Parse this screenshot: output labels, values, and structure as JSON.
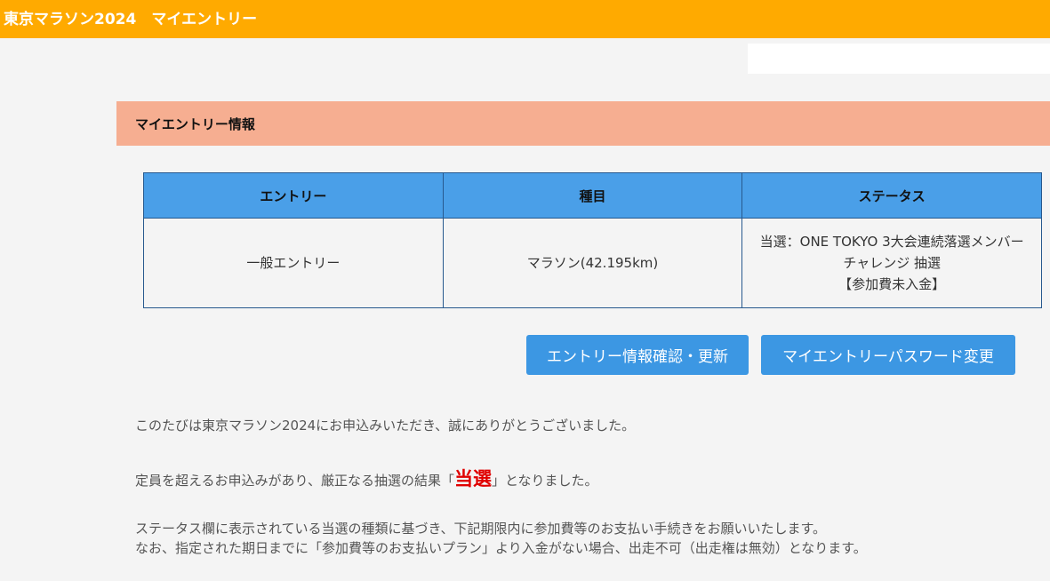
{
  "header": {
    "title": "東京マラソン2024　マイエントリー"
  },
  "section": {
    "title": "マイエントリー情報"
  },
  "table": {
    "headers": [
      "エントリー",
      "種目",
      "ステータス"
    ],
    "rows": [
      {
        "entry": "一般エントリー",
        "event": "マラソン(42.195km)",
        "status_line1": "当選：ONE TOKYO 3大会連続落選メンバーチャレンジ 抽選",
        "status_line2": "【参加費未入金】"
      }
    ]
  },
  "buttons": {
    "entry_info": "エントリー情報確認・更新",
    "password_change": "マイエントリーパスワード変更"
  },
  "messages": {
    "thanks": "このたびは東京マラソン2024にお申込みいただき、誠にありがとうございました。",
    "result_prefix": "定員を超えるお申込みがあり、厳正なる抽選の結果「",
    "result_highlight": "当選",
    "result_suffix": "」となりました。",
    "instruction_line1": "ステータス欄に表示されている当選の種類に基づき、下記期限内に参加費等のお支払い手続きをお願いいたします。",
    "instruction_line2": "なお、指定された期日までに「参加費等のお支払いプラン」より入金がない場合、出走不可（出走権は無効）となります。"
  },
  "colors": {
    "header_bg": "#ffaa00",
    "section_bg": "#f6ae91",
    "table_header_bg": "#4a9fe8",
    "button_bg": "#3c97e3",
    "highlight": "#e00000"
  }
}
